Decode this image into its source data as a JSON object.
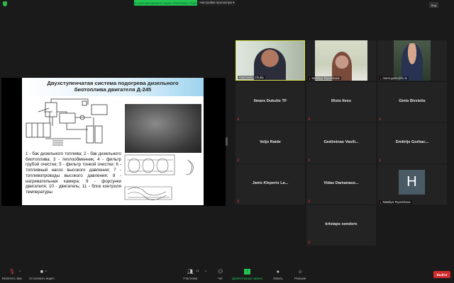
{
  "top_bar": {
    "viewing_banner": "Вы просматриваете экран Vlacheslav Chuba",
    "view_options": "Настройки просмотра ▾",
    "view_button": "Вид"
  },
  "slide": {
    "title_line1": "Двухступенчатая система подогрева дизельного",
    "title_line2": "биотоплива двигателя Д-245",
    "legend": "1 - бак дизельного топлива; 2 - бак дизельного биотоплива; 3 - теплообменник; 4 - фильтр грубой очистки; 5 - фильтр тонкой очистки; 6 - топливный насос высокого давления; 7 - топливопроводы высокого давления; 8 - нагревательная камера; 9 - форсунки двигателя; 10 - двигатель; 11 - блок контроля температуры"
  },
  "participants": [
    {
      "name": "Viacheslav Chuba",
      "video": true,
      "active": true,
      "muted": false
    },
    {
      "name": "Nataliya Tsyvenkova",
      "video": true,
      "muted": true
    },
    {
      "name": "maris.gailis@llu.lv",
      "video": true,
      "muted": true
    },
    {
      "name": "Ilmars Dukulis TF",
      "muted": true
    },
    {
      "name": "Risto Ilves",
      "muted": true
    },
    {
      "name": "Gints Birzietis",
      "muted": true
    },
    {
      "name": "Veljo Raide",
      "muted": true
    },
    {
      "name": "Gediminas Vasili...",
      "muted": true
    },
    {
      "name": "Dmitrijs Gorbac...",
      "muted": true
    },
    {
      "name": "Janis Kleperis La...",
      "muted": true
    },
    {
      "name": "Vidas Damanaus...",
      "muted": true
    },
    {
      "name": "Nataliya Tsyvenkova",
      "avatar_letter": "H",
      "muted": true
    },
    {
      "name": "kristaps sondors",
      "muted": true
    }
  ],
  "toolbar": {
    "unmute": "Включить звук",
    "stop_video": "Остановить видео",
    "participants": "Участники",
    "participants_count": "13",
    "chat": "Чат",
    "share_screen": "Демонстрация экрана",
    "record": "Запись",
    "reactions": "Реакции",
    "leave": "Выйти"
  },
  "colors": {
    "share_green": "#23c552",
    "leave_red": "#d22c2c",
    "active_border": "#d5e34a",
    "avatar_bg": "#4a5b66"
  }
}
